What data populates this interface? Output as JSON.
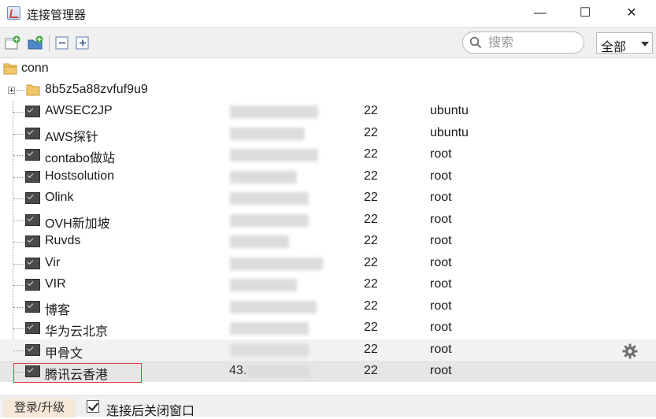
{
  "window": {
    "title": "连接管理器",
    "minimize_label": "—",
    "maximize_label": "☐",
    "close_label": "✕"
  },
  "toolbar": {
    "icons": [
      "new-session-icon",
      "new-folder-icon",
      "collapse-all-icon",
      "expand-all-icon"
    ],
    "search_placeholder": "搜索",
    "filter_selected": "全部"
  },
  "tree": {
    "root": "conn",
    "group": "8b5z5a88zvfuf9u9",
    "sessions": [
      {
        "name": "AWSEC2JP",
        "port": "22",
        "user": "ubuntu"
      },
      {
        "name": "AWS探针",
        "port": "22",
        "user": "ubuntu"
      },
      {
        "name": "contabo做站",
        "port": "22",
        "user": "root"
      },
      {
        "name": "Hostsolution",
        "port": "22",
        "user": "root"
      },
      {
        "name": "Olink",
        "port": "22",
        "user": "root"
      },
      {
        "name": "OVH新加坡",
        "port": "22",
        "user": "root"
      },
      {
        "name": "Ruvds",
        "port": "22",
        "user": "root"
      },
      {
        "name": "Vir",
        "port": "22",
        "user": "root"
      },
      {
        "name": "VIR",
        "port": "22",
        "user": "root"
      },
      {
        "name": "博客",
        "port": "22",
        "user": "root"
      },
      {
        "name": "华为云北京",
        "port": "22",
        "user": "root"
      },
      {
        "name": "甲骨文",
        "port": "22",
        "user": "root"
      },
      {
        "name": "腾讯云香港",
        "host_prefix": "43.",
        "port": "22",
        "user": "root"
      }
    ]
  },
  "statusbar": {
    "login_label": "登录/升级",
    "close_after_connect_label": "连接后关闭窗口",
    "close_after_connect_checked": true
  }
}
